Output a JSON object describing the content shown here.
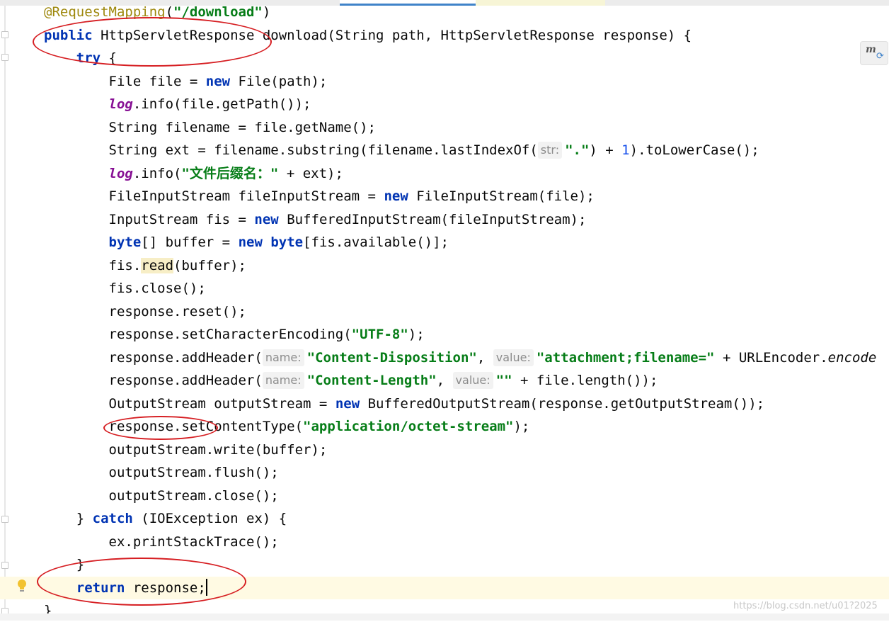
{
  "editor": {
    "lines": [
      [
        {
          "t": "@RequestMapping",
          "c": "ann"
        },
        {
          "t": "(",
          "c": ""
        },
        {
          "t": "\"/download\"",
          "c": "str"
        },
        {
          "t": ")",
          "c": ""
        }
      ],
      [
        {
          "t": "public ",
          "c": "kw"
        },
        {
          "t": "HttpServletResponse download(String path, HttpServletResponse response) {",
          "c": ""
        }
      ],
      [
        {
          "t": "    try ",
          "c": "kw"
        },
        {
          "t": "{",
          "c": ""
        }
      ],
      [
        {
          "t": "        File file = ",
          "c": ""
        },
        {
          "t": "new ",
          "c": "kw"
        },
        {
          "t": "File(path);",
          "c": ""
        }
      ],
      [
        {
          "t": "        ",
          "c": ""
        },
        {
          "t": "log",
          "c": "fld"
        },
        {
          "t": ".info(file.getPath());",
          "c": ""
        }
      ],
      [
        {
          "t": "        String filename = file.getName();",
          "c": ""
        }
      ],
      [
        {
          "t": "        String ext = filename.substring(filename.lastIndexOf(",
          "c": ""
        },
        {
          "t": "str:",
          "c": "hint"
        },
        {
          "t": "\".\"",
          "c": "str"
        },
        {
          "t": ") + ",
          "c": ""
        },
        {
          "t": "1",
          "c": "num"
        },
        {
          "t": ").toLowerCase();",
          "c": ""
        }
      ],
      [
        {
          "t": "        ",
          "c": ""
        },
        {
          "t": "log",
          "c": "fld"
        },
        {
          "t": ".info(",
          "c": ""
        },
        {
          "t": "\"文件后缀名：\"",
          "c": "str"
        },
        {
          "t": " + ext);",
          "c": ""
        }
      ],
      [
        {
          "t": "        FileInputStream fileInputStream = ",
          "c": ""
        },
        {
          "t": "new ",
          "c": "kw"
        },
        {
          "t": "FileInputStream(file);",
          "c": ""
        }
      ],
      [
        {
          "t": "        InputStream fis = ",
          "c": ""
        },
        {
          "t": "new ",
          "c": "kw"
        },
        {
          "t": "BufferedInputStream(fileInputStream);",
          "c": ""
        }
      ],
      [
        {
          "t": "        ",
          "c": ""
        },
        {
          "t": "byte",
          "c": "kw"
        },
        {
          "t": "[] buffer = ",
          "c": ""
        },
        {
          "t": "new ",
          "c": "kw"
        },
        {
          "t": "byte",
          "c": "kw"
        },
        {
          "t": "[fis.available()];",
          "c": ""
        }
      ],
      [
        {
          "t": "        fis.",
          "c": ""
        },
        {
          "t": "read",
          "c": "hl-read"
        },
        {
          "t": "(buffer);",
          "c": ""
        }
      ],
      [
        {
          "t": "        fis.close();",
          "c": ""
        }
      ],
      [
        {
          "t": "        response.reset();",
          "c": ""
        }
      ],
      [
        {
          "t": "        response.setCharacterEncoding(",
          "c": ""
        },
        {
          "t": "\"UTF-8\"",
          "c": "str"
        },
        {
          "t": ");",
          "c": ""
        }
      ],
      [
        {
          "t": "        response.addHeader(",
          "c": ""
        },
        {
          "t": "name:",
          "c": "hint"
        },
        {
          "t": "\"Content-Disposition\"",
          "c": "str"
        },
        {
          "t": ", ",
          "c": ""
        },
        {
          "t": "value:",
          "c": "hint"
        },
        {
          "t": "\"attachment;filename=\"",
          "c": "str"
        },
        {
          "t": " + URLEncoder.",
          "c": ""
        },
        {
          "t": "encode",
          "c": "it"
        }
      ],
      [
        {
          "t": "        response.addHeader(",
          "c": ""
        },
        {
          "t": "name:",
          "c": "hint"
        },
        {
          "t": "\"Content-Length\"",
          "c": "str"
        },
        {
          "t": ", ",
          "c": ""
        },
        {
          "t": "value:",
          "c": "hint"
        },
        {
          "t": "\"\"",
          "c": "str"
        },
        {
          "t": " + file.length());",
          "c": ""
        }
      ],
      [
        {
          "t": "        OutputStream outputStream = ",
          "c": ""
        },
        {
          "t": "new ",
          "c": "kw"
        },
        {
          "t": "BufferedOutputStream(response.getOutputStream());",
          "c": ""
        }
      ],
      [
        {
          "t": "        response.setContentType(",
          "c": ""
        },
        {
          "t": "\"application/octet-stream\"",
          "c": "str"
        },
        {
          "t": ");",
          "c": ""
        }
      ],
      [
        {
          "t": "        outputStream.write(buffer);",
          "c": ""
        }
      ],
      [
        {
          "t": "        outputStream.flush();",
          "c": ""
        }
      ],
      [
        {
          "t": "        outputStream.close();",
          "c": ""
        }
      ],
      [
        {
          "t": "    } ",
          "c": ""
        },
        {
          "t": "catch ",
          "c": "kw"
        },
        {
          "t": "(IOException ex) {",
          "c": ""
        }
      ],
      [
        {
          "t": "        ex.printStackTrace();",
          "c": ""
        }
      ],
      [
        {
          "t": "    }",
          "c": ""
        }
      ],
      [
        {
          "t": "    return ",
          "c": "kw"
        },
        {
          "t": "response;",
          "c": ""
        },
        {
          "t": "",
          "c": "caret"
        }
      ],
      [
        {
          "t": "}",
          "c": ""
        }
      ]
    ]
  },
  "colors": {
    "keyword": "#0033b3",
    "string": "#067d17",
    "annotation": "#9e880d",
    "static_field": "#871094",
    "number": "#1750eb",
    "caret_line": "#fffae3",
    "annotation_circle": "#d61e22"
  },
  "icons": {
    "maven_reload": "maven-reload-icon",
    "intention_bulb": "lightbulb-icon"
  },
  "maven_button": {
    "glyph": "m",
    "refresh_glyph": "⟳"
  },
  "watermark": "https://blog.csdn.net/u01?2025"
}
